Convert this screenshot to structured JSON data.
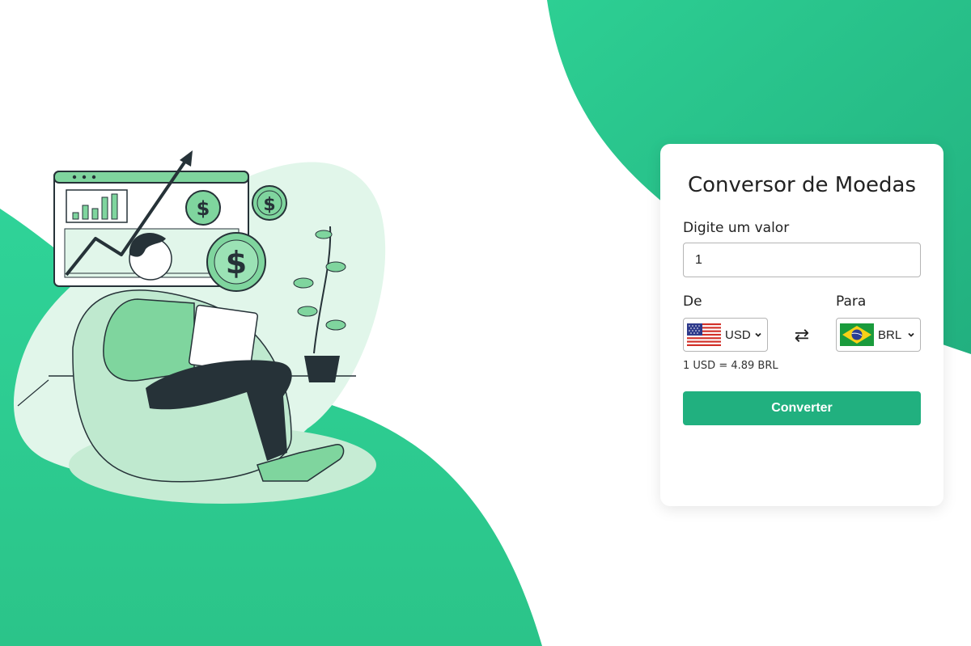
{
  "converter": {
    "title": "Conversor de Moedas",
    "amount_label": "Digite um valor",
    "amount_value": "1",
    "from_label": "De",
    "to_label": "Para",
    "from_currency": "USD",
    "to_currency": "BRL",
    "swap_symbol": "⇄",
    "rate_text": "1 USD = 4.89 BRL",
    "convert_label": "Converter"
  },
  "theme": {
    "accent": "#2ecf96",
    "accent_dark": "#21b07f",
    "illustration_light": "#e1f6ea",
    "illustration_mid": "#7fd59e",
    "dark": "#263238"
  },
  "icons": {
    "from_flag": "us-flag-icon",
    "to_flag": "brazil-flag-icon",
    "swap": "swap-arrows-icon",
    "dropdown": "chevron-down-icon"
  }
}
